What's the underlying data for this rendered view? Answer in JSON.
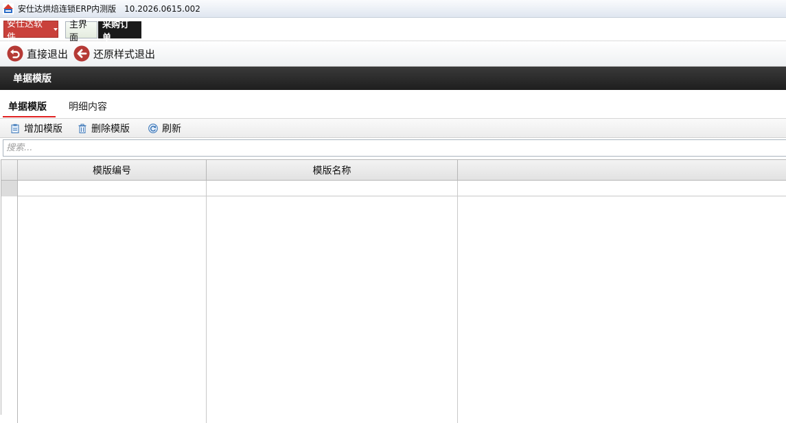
{
  "window": {
    "title": "安仕达烘焙连锁ERP内测版",
    "version": "10.2026.0615.002",
    "app_icon": "app-logo-icon"
  },
  "menubar": {
    "brand_menu_label": "安仕达软件",
    "tabs": [
      {
        "label": "主界面",
        "active": false
      },
      {
        "label": "采购订单",
        "active": true
      }
    ]
  },
  "toolbar": {
    "exit_label": "直接退出",
    "exit_icon": "undo-circle-icon",
    "restore_exit_label": "还原样式退出",
    "restore_exit_icon": "arrow-left-circle-icon"
  },
  "section": {
    "title": "单据模版"
  },
  "subtabs": [
    {
      "label": "单据模版",
      "active": true
    },
    {
      "label": "明细内容",
      "active": false
    }
  ],
  "actions": {
    "add_label": "增加模版",
    "add_icon": "clipboard-add-icon",
    "delete_label": "删除模版",
    "delete_icon": "trash-icon",
    "refresh_label": "刷新",
    "refresh_icon": "refresh-icon"
  },
  "search": {
    "placeholder": "搜索...",
    "value": ""
  },
  "grid": {
    "columns": [
      "模版编号",
      "模版名称",
      ""
    ],
    "rows": [
      {
        "code": "",
        "name": ""
      }
    ]
  },
  "colors": {
    "brand_red": "#c9413b",
    "header_dark": "#1e1e1e",
    "active_underline": "#e02020",
    "icon_red": "#b53a36"
  }
}
